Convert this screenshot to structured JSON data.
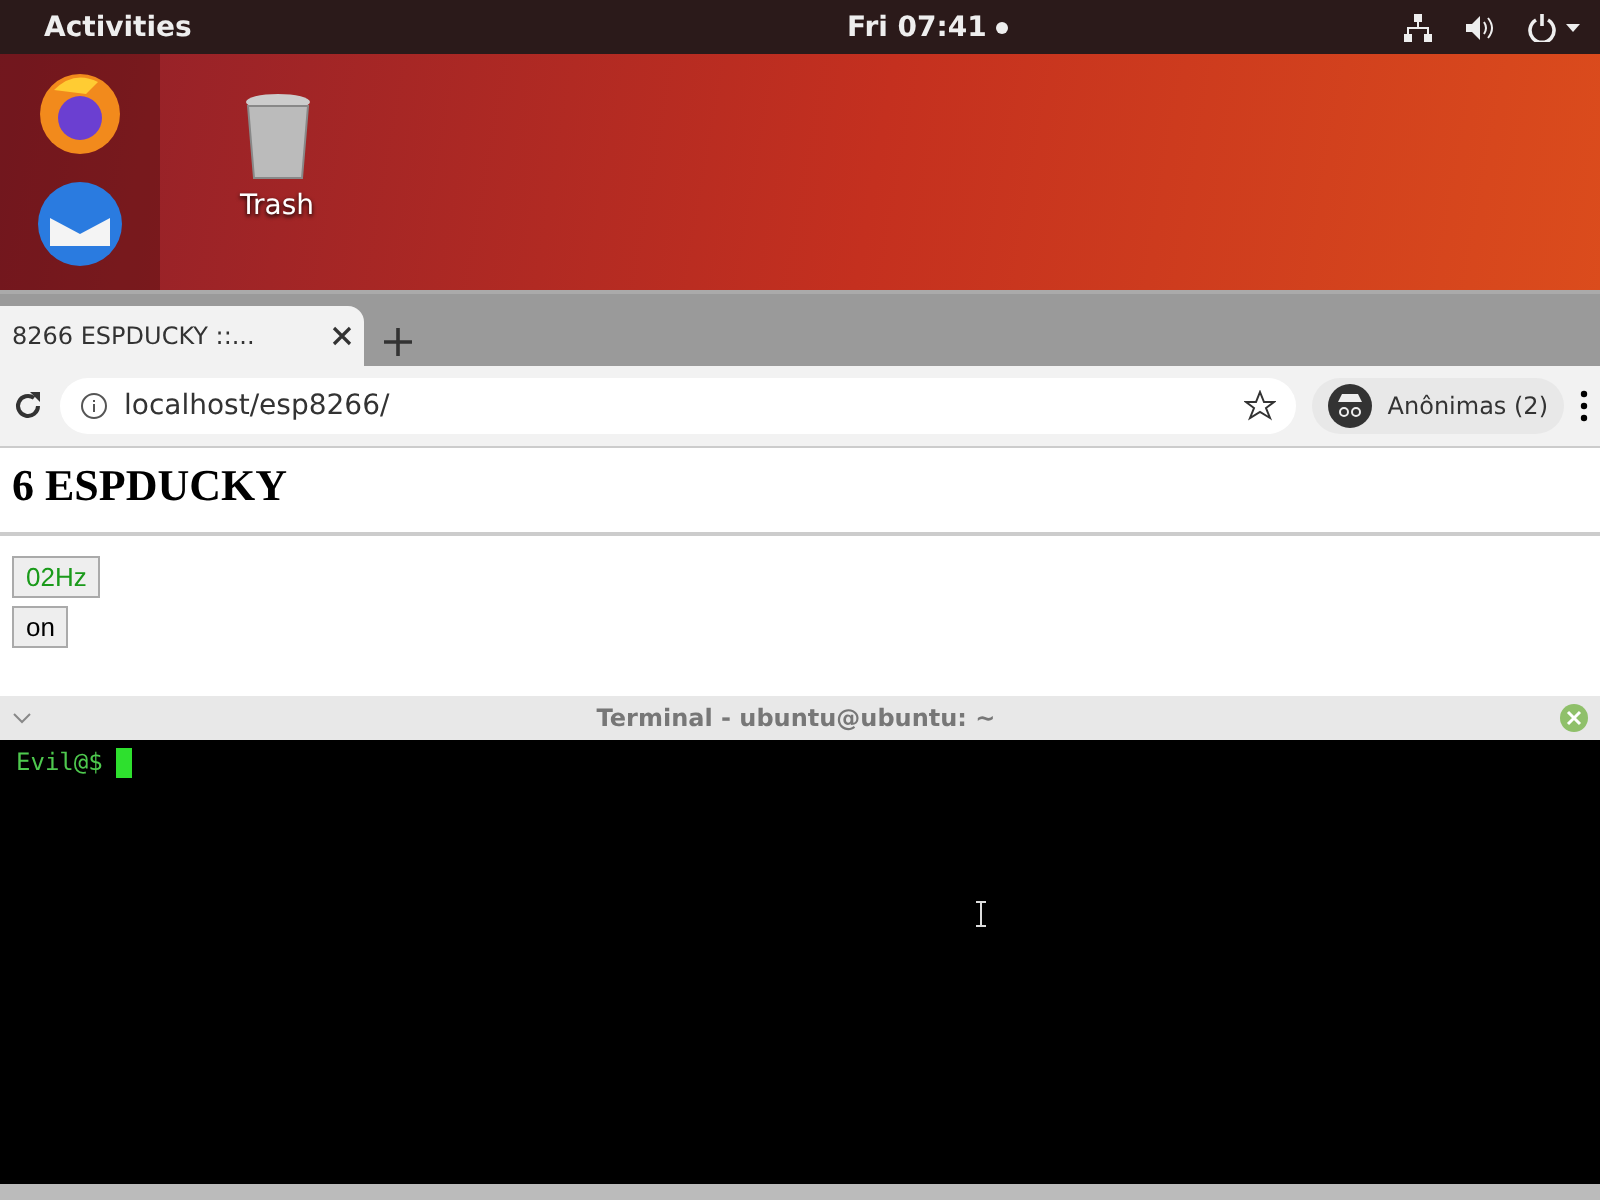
{
  "top_bar": {
    "activities": "Activities",
    "clock": "Fri 07:41"
  },
  "desktop": {
    "icons": [
      {
        "label": "Trash"
      }
    ]
  },
  "browser": {
    "tab": {
      "title": "8266 ESPDUCKY ::...",
      "selected": true
    },
    "address": "localhost/esp8266/",
    "profile": "Anônimas (2)",
    "heading": "6 ESPDUCKY",
    "buttons": [
      {
        "label": "02Hz",
        "kind": "green"
      },
      {
        "label": "on",
        "kind": "plain"
      }
    ]
  },
  "terminal": {
    "title": "Terminal - ubuntu@ubuntu: ~",
    "prompt": "Evil@$"
  }
}
